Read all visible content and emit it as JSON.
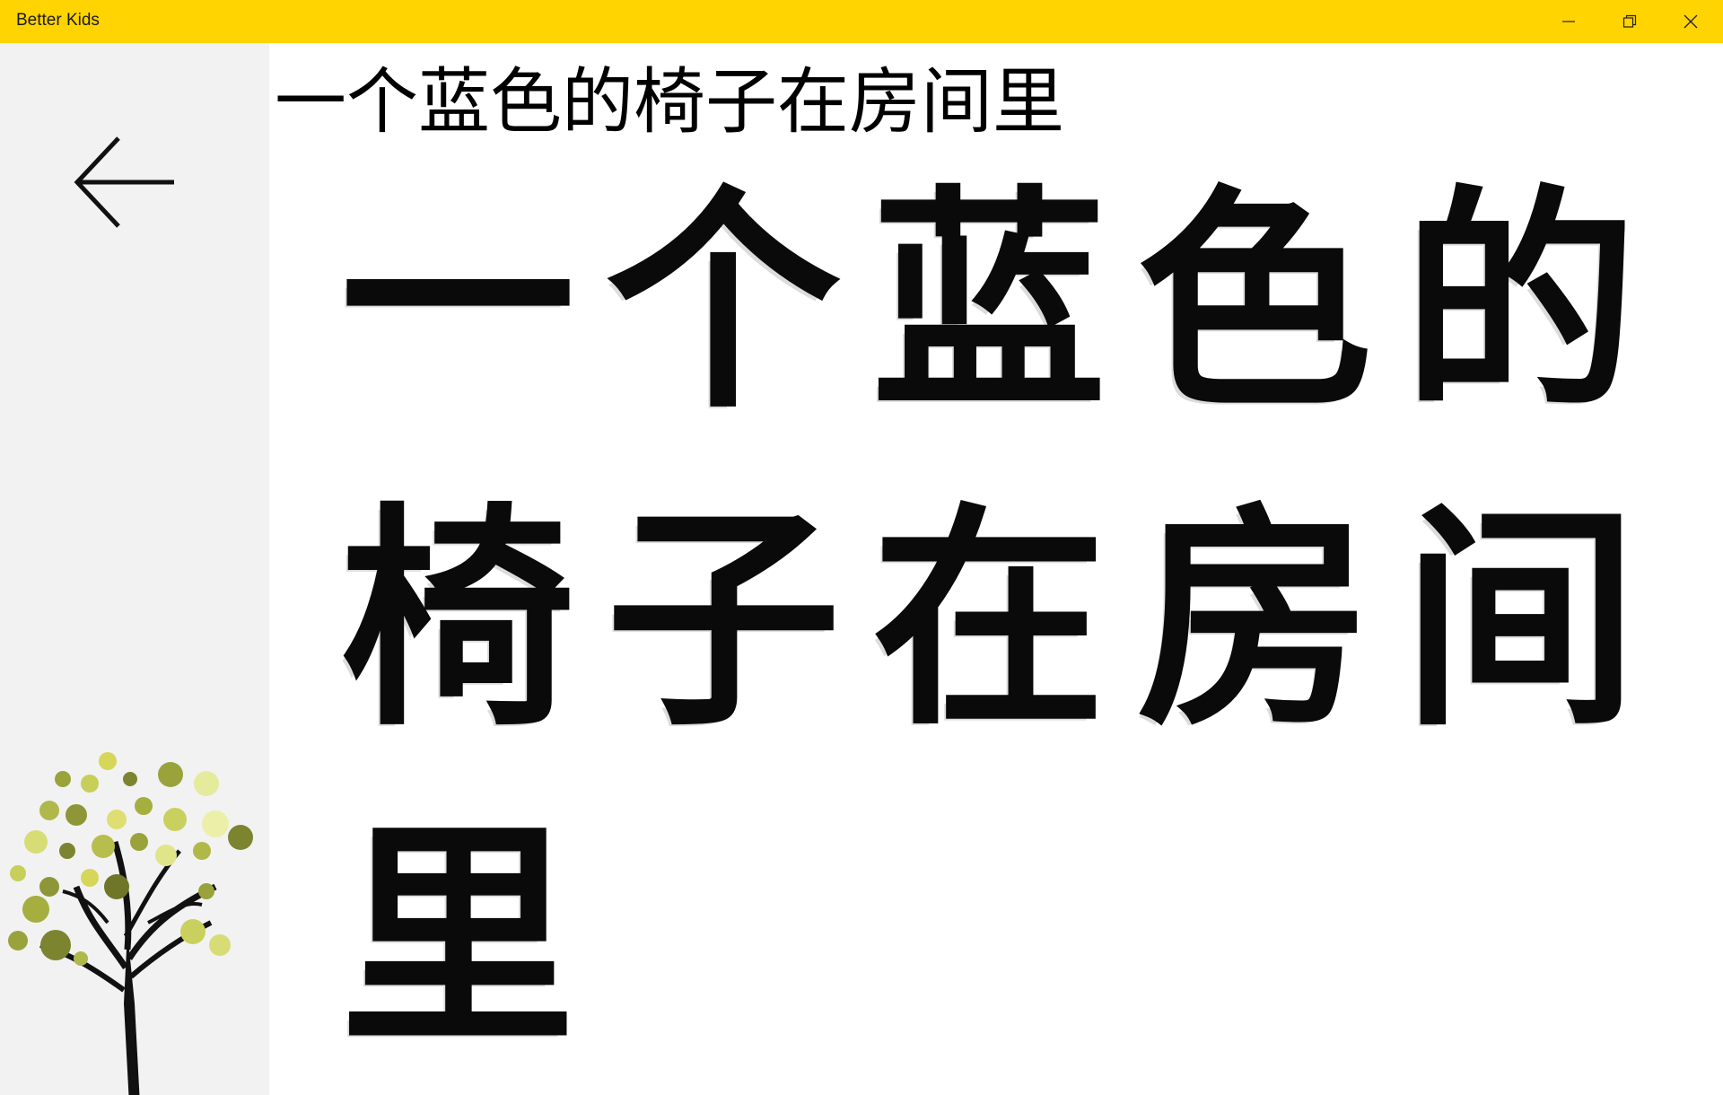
{
  "window": {
    "title": "Better Kids",
    "titlebar_color": "#ffd400",
    "controls": [
      "minimize-icon",
      "restore-icon",
      "close-icon"
    ]
  },
  "sidebar": {
    "background": "#f2f2f2",
    "back_icon": "arrow-left-icon",
    "decoration_icon": "fruit-tree-icon"
  },
  "main": {
    "sentence": "一个蓝色的椅子在房间里",
    "characters": [
      "一",
      "个",
      "蓝",
      "色",
      "的",
      "椅",
      "子",
      "在",
      "房",
      "间",
      "里"
    ]
  }
}
